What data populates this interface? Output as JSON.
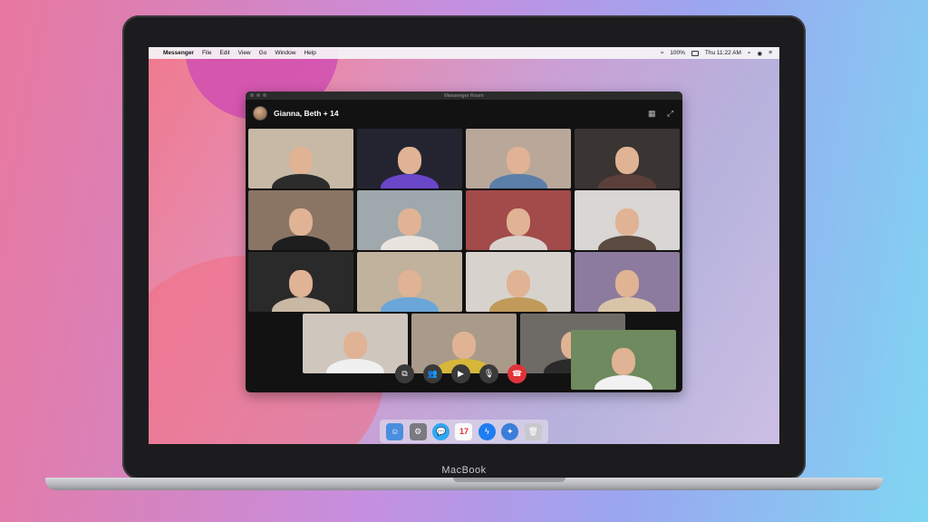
{
  "menubar": {
    "app_name": "Messenger",
    "items": [
      "File",
      "Edit",
      "View",
      "Go",
      "Window",
      "Help"
    ],
    "battery": "100%",
    "clock": "Thu 11:22 AM"
  },
  "window": {
    "title": "Messenger Room",
    "participants_label": "Gianna, Beth + 14"
  },
  "tiles": [
    {
      "bg": "#c7b9a6",
      "shirt": "#2c2c2c"
    },
    {
      "bg": "#242431",
      "shirt": "#6a46c9"
    },
    {
      "bg": "#b9a89a",
      "shirt": "#5b7fa8"
    },
    {
      "bg": "#3a3432",
      "shirt": "#5b3f3a"
    },
    {
      "bg": "#8a7565",
      "shirt": "#1e1e1e"
    },
    {
      "bg": "#9ea8ad",
      "shirt": "#e8e3dc"
    },
    {
      "bg": "#a34a4a",
      "shirt": "#d9d2cc"
    },
    {
      "bg": "#d9d6d4",
      "shirt": "#5a4a40"
    },
    {
      "bg": "#2a2a2a",
      "shirt": "#c9b8a3"
    },
    {
      "bg": "#c1b29e",
      "shirt": "#6aa6d8"
    },
    {
      "bg": "#d7d2cc",
      "shirt": "#c19a5b"
    },
    {
      "bg": "#8c7b9e",
      "shirt": "#d9c4a8"
    },
    {
      "bg": "#cfc6bd",
      "shirt": "#f0f0f0"
    },
    {
      "bg": "#a99a8a",
      "shirt": "#d7b73a"
    },
    {
      "bg": "#6e6b66",
      "shirt": "#2a2a2a"
    },
    {
      "bg": "#6f8a5e",
      "shirt": "#f2f2f2"
    }
  ],
  "dock": {
    "icons": [
      "finder-icon",
      "system-preferences-icon",
      "messages-icon",
      "calendar-icon",
      "messenger-icon",
      "safari-icon",
      "trash-icon"
    ],
    "calendar_date": "17"
  },
  "laptop": {
    "label": "MacBook"
  },
  "colors": {
    "end_call": "#e0333a",
    "messenger_blue": "#1f7cf2"
  }
}
